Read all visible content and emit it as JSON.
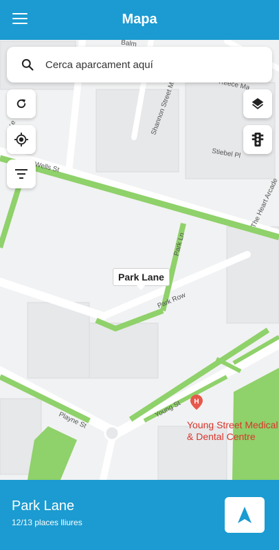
{
  "header": {
    "title": "Mapa",
    "menu_icon": "menu-icon"
  },
  "search": {
    "placeholder": "Cerca aparcament aquí",
    "icon": "search-icon"
  },
  "map_controls": {
    "left": [
      {
        "name": "refresh-button",
        "icon": "refresh-icon"
      },
      {
        "name": "my-location-button",
        "icon": "location-target-icon"
      },
      {
        "name": "filter-button",
        "icon": "filter-icon"
      }
    ],
    "right": [
      {
        "name": "layers-button",
        "icon": "layers-icon"
      },
      {
        "name": "traffic-button",
        "icon": "traffic-light-icon"
      }
    ]
  },
  "map": {
    "marker_label": "Park Lane",
    "streets": [
      "Balm",
      "Shannon Street Ma",
      "Reece Ma",
      "Stiebel Pl",
      "The Heart Arcade",
      "Wells St",
      "Park Ln",
      "Park Row",
      "Young St",
      "Playne St",
      "Ke"
    ],
    "poi": {
      "line1": "Young Street Medical",
      "line2": "& Dental Centre",
      "icon": "hospital-pin-icon"
    },
    "colors": {
      "parking_green": "#8fd16a",
      "road": "#ffffff",
      "block": "#e6e7e9"
    }
  },
  "bottom_sheet": {
    "name": "Park Lane",
    "availability": "12/13 places lliures",
    "navigate_icon": "navigation-arrow-icon"
  },
  "colors": {
    "primary": "#1b9bd1"
  }
}
